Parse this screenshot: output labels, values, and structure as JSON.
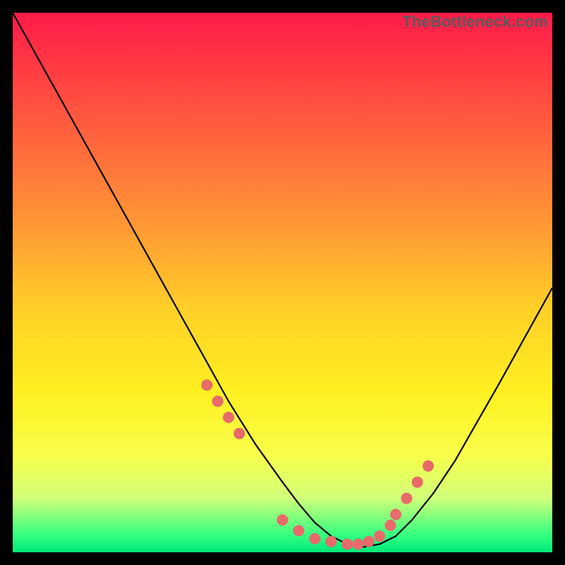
{
  "watermark": "TheBottleneck.com",
  "chart_data": {
    "type": "line",
    "title": "",
    "xlabel": "",
    "ylabel": "",
    "xlim": [
      0,
      100
    ],
    "ylim": [
      0,
      100
    ],
    "grid": false,
    "legend": false,
    "series": [
      {
        "name": "bottleneck-curve",
        "x": [
          0,
          5,
          10,
          15,
          20,
          25,
          30,
          35,
          40,
          45,
          50,
          53,
          56,
          59,
          62,
          65,
          68,
          71,
          74,
          78,
          82,
          86,
          90,
          95,
          100
        ],
        "values": [
          100,
          91,
          82,
          73,
          64,
          55,
          46,
          37,
          28,
          20,
          13,
          9,
          5.5,
          3,
          1.5,
          1,
          1.5,
          3,
          6,
          11,
          17,
          24,
          31,
          40,
          49
        ]
      }
    ],
    "markers": {
      "name": "highlighted-points",
      "x": [
        36,
        38,
        40,
        42,
        50,
        53,
        56,
        59,
        62,
        64,
        66,
        68,
        70,
        71,
        73,
        75,
        77
      ],
      "values": [
        31,
        28,
        25,
        22,
        6,
        4,
        2.5,
        2,
        1.5,
        1.5,
        2,
        3,
        5,
        7,
        10,
        13,
        16
      ]
    },
    "colors": {
      "curve": "#000000",
      "markers": "#e86a6a",
      "gradient_top": "#ff1a4a",
      "gradient_bottom": "#00e878"
    }
  }
}
